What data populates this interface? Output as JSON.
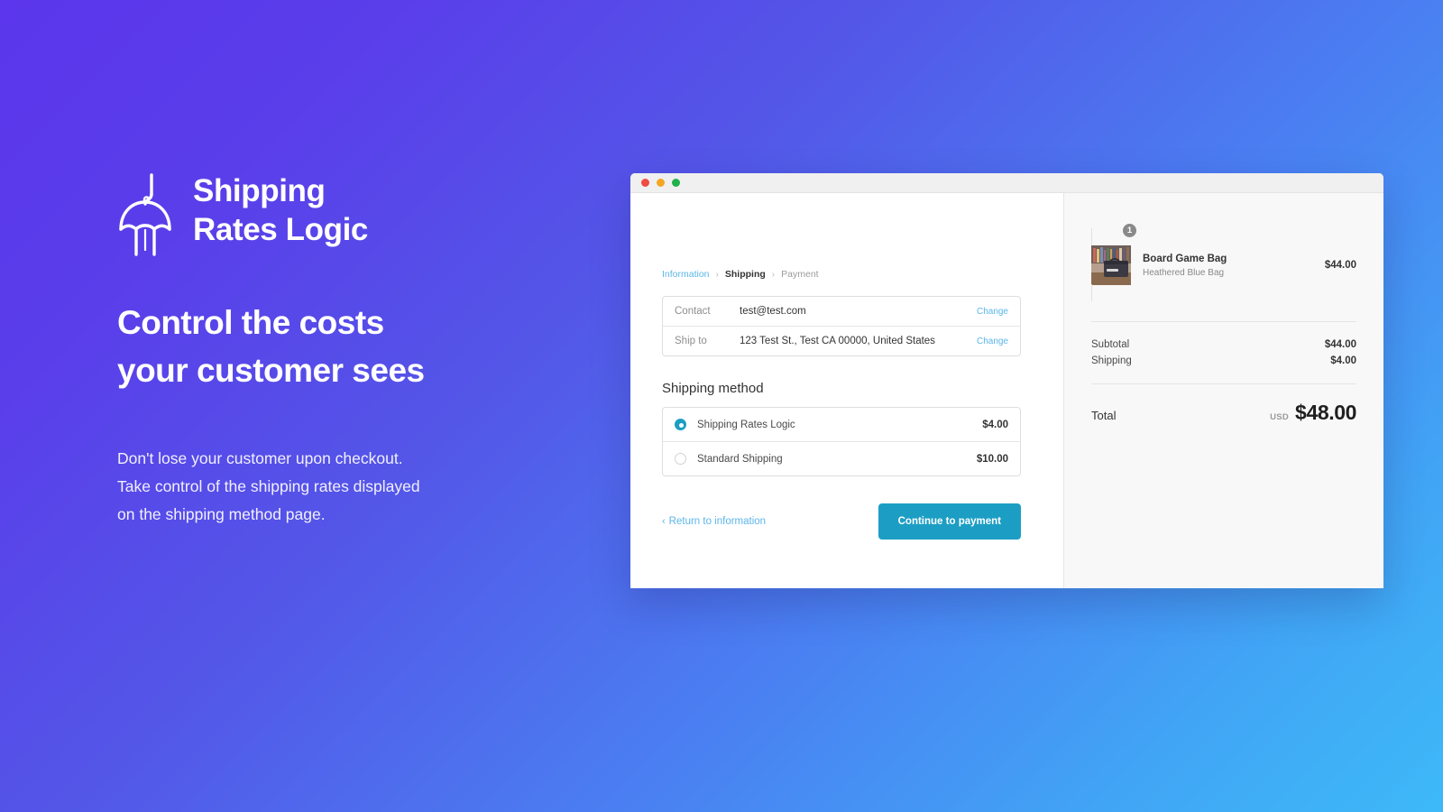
{
  "brand": {
    "logo_icon": "parachute-package-icon",
    "title": "Shipping\nRates Logic"
  },
  "marketing": {
    "headline": "Control the costs\nyour customer sees",
    "subcopy": "Don't lose your customer upon checkout.\nTake control of the shipping rates displayed\non the shipping method page."
  },
  "window": {
    "traffic_lights": [
      "close-red",
      "minimize-yellow",
      "maximize-green"
    ]
  },
  "checkout": {
    "breadcrumb": [
      {
        "label": "Information",
        "state": "link"
      },
      {
        "label": "Shipping",
        "state": "current"
      },
      {
        "label": "Payment",
        "state": "upcoming"
      }
    ],
    "breadcrumb_separator": "›",
    "info_rows": [
      {
        "label": "Contact",
        "value": "test@test.com",
        "action": "Change"
      },
      {
        "label": "Ship to",
        "value": "123 Test St., Test CA 00000, United States",
        "action": "Change"
      }
    ],
    "shipping_section_title": "Shipping method",
    "shipping_options": [
      {
        "name": "Shipping Rates Logic",
        "price": "$4.00",
        "selected": true
      },
      {
        "name": "Standard Shipping",
        "price": "$10.00",
        "selected": false
      }
    ],
    "return_link": "Return to information",
    "return_chevron": "‹",
    "continue_button": "Continue to payment"
  },
  "summary": {
    "line_item": {
      "quantity": "1",
      "name": "Board Game Bag",
      "variant": "Heathered Blue Bag",
      "price": "$44.00",
      "thumbnail_icon": "product-photo-board-game-bag"
    },
    "totals": [
      {
        "label": "Subtotal",
        "amount": "$44.00"
      },
      {
        "label": "Shipping",
        "amount": "$4.00"
      }
    ],
    "grand_total": {
      "label": "Total",
      "currency": "USD",
      "amount": "$48.00"
    }
  },
  "colors": {
    "bg_gradient_start": "#5B36EC",
    "bg_gradient_end": "#3DB9F8",
    "accent_teal": "#1C9EC4",
    "link_blue": "#5BB6E8",
    "badge_gray": "#8A8A8A"
  }
}
